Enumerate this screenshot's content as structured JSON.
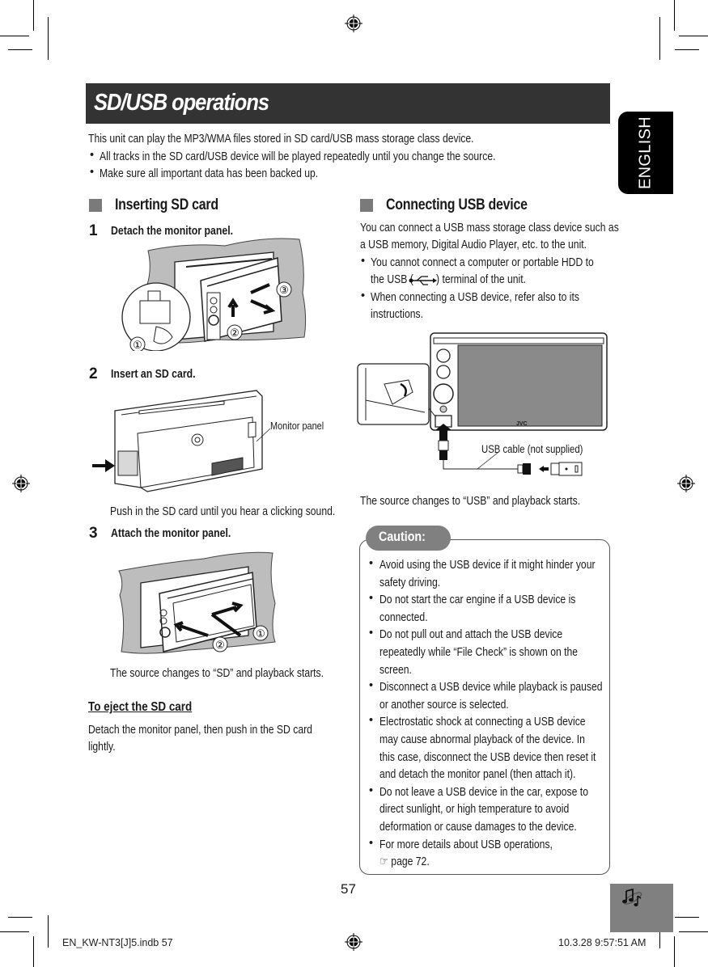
{
  "page": {
    "title": "SD/USB operations",
    "language_tab": "ENGLISH",
    "intro": "This unit can play the MP3/WMA files stored in SD card/USB mass storage class device.",
    "intro_bullets": [
      "All tracks in the SD card/USB device will be played repeatedly until you change the source.",
      "Make sure all important data has been backed up."
    ],
    "bullet_char": "•",
    "page_number": "57",
    "music_icon": "music-notes-icon"
  },
  "inserting": {
    "heading": "Inserting SD card",
    "steps": [
      {
        "number": "1",
        "label": "Detach the monitor panel."
      },
      {
        "number": "2",
        "label": "Insert an SD card."
      },
      {
        "number": "3",
        "label": "Attach the monitor panel."
      }
    ],
    "callouts": {
      "step1": [
        "1",
        "2",
        "3"
      ],
      "step3": [
        "2",
        "1"
      ]
    },
    "monitor_panel_label": "Monitor panel",
    "step2_note": "Push in the SD card until you hear a clicking sound.",
    "step3_note": "The source changes to “SD” and playback starts.",
    "eject_title": "To eject the SD card",
    "eject_text": [
      "Detach the monitor panel, then push in the SD card",
      "lightly."
    ]
  },
  "usb": {
    "heading": "Connecting USB device",
    "intro": [
      "You can connect a USB mass storage class device such as",
      "a USB memory, Digital Audio Player, etc. to the unit."
    ],
    "bullets": [
      [
        "You cannot connect a computer or portable HDD to",
        "the USB (",
        ") terminal of the unit."
      ],
      [
        "When connecting a USB device, refer also to its",
        "instructions."
      ]
    ],
    "usb_symbol": "usb-icon",
    "brand_label": "JVC",
    "cable_label": "USB cable (not supplied)",
    "result": "The source changes to “USB” and playback starts."
  },
  "caution": {
    "badge": "Caution:",
    "items": [
      [
        "Avoid using the USB device if it might hinder your",
        "safety driving."
      ],
      [
        "Do not start the car engine if a USB device is",
        "connected."
      ],
      [
        "Do not pull out and attach the USB device",
        "repeatedly while “File Check” is shown on the",
        "screen."
      ],
      [
        "Disconnect a USB device while playback is paused",
        "or another source is selected."
      ],
      [
        "Electrostatic shock at connecting a USB device",
        "may cause abnormal playback of the device. In",
        "this case, disconnect the USB device then reset it",
        "and detach the monitor panel (then attach it)."
      ],
      [
        "Do not leave a USB device in the car, expose to",
        "direct sunlight, or high temperature to avoid",
        "deformation or cause damages to the device."
      ],
      [
        "For more details about USB operations,",
        "☞ page 72."
      ]
    ]
  },
  "footer": {
    "file": "EN_KW-NT3[J]5.indb   57",
    "timestamp": "10.3.28   9:57:51 AM"
  }
}
